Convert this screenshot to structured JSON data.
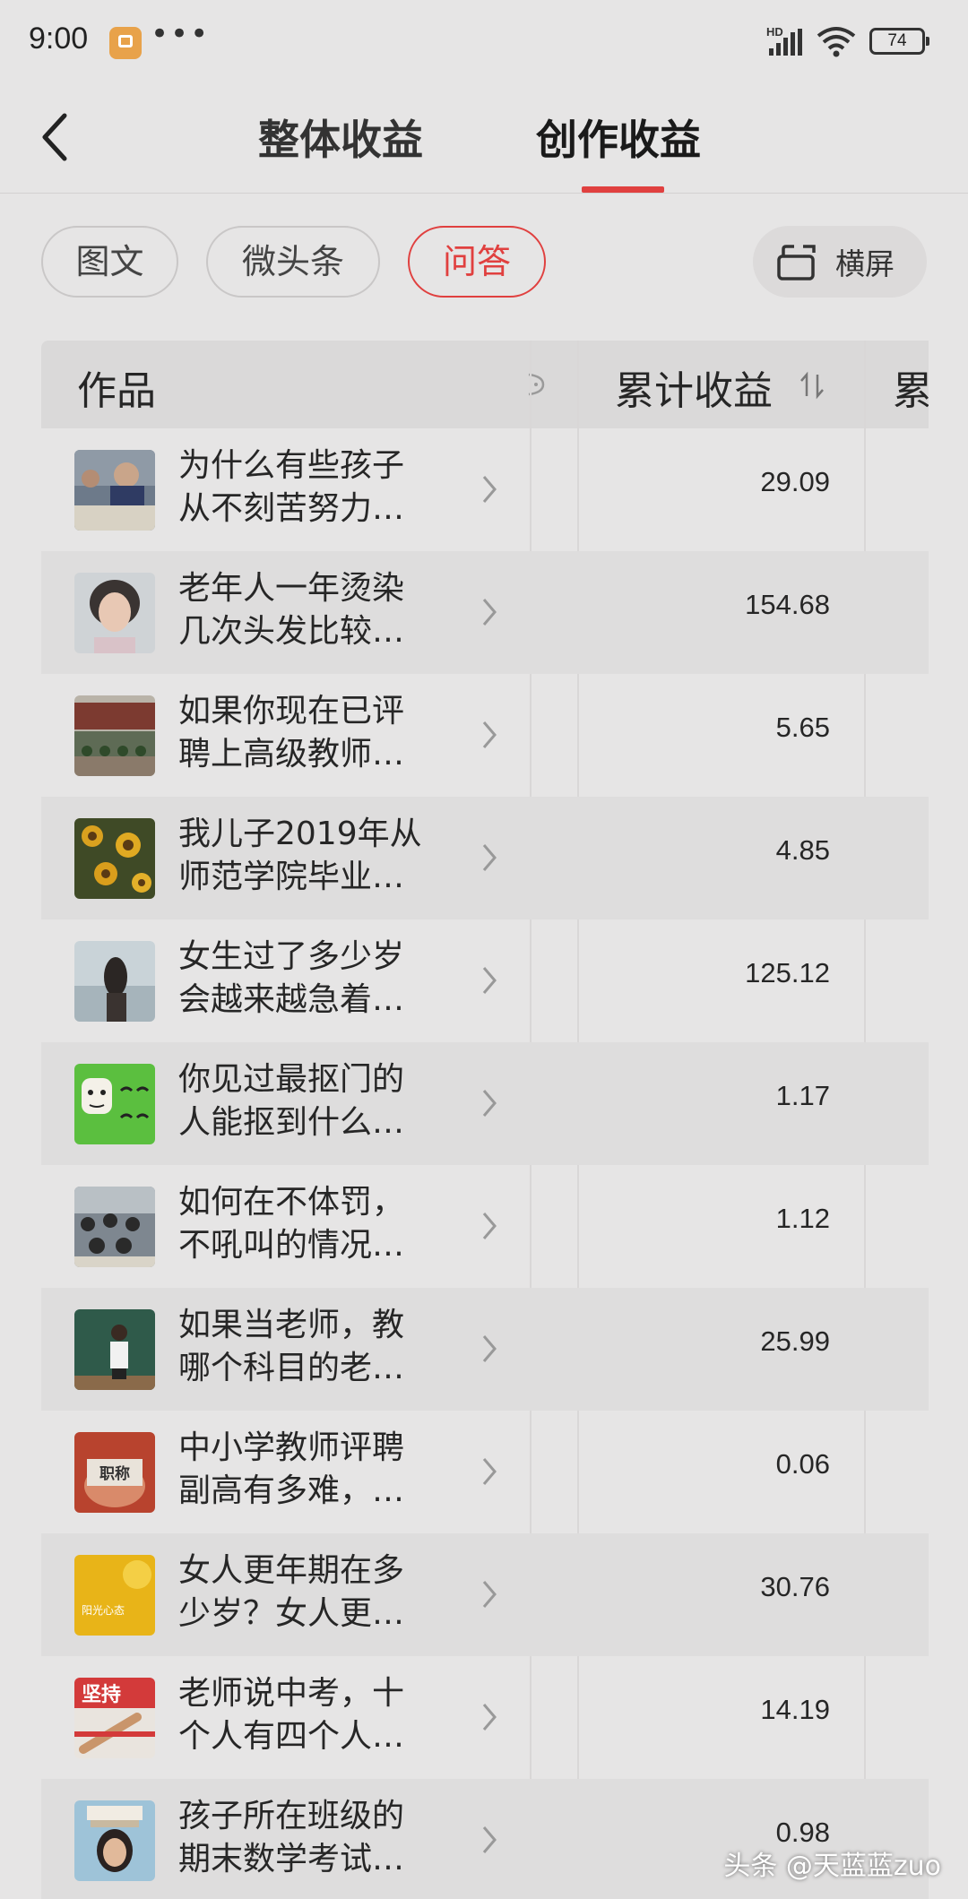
{
  "status": {
    "time": "9:00",
    "hd": "HD",
    "battery": "74"
  },
  "nav": {
    "tabs": [
      "整体收益",
      "创作收益"
    ],
    "active_tab": "创作收益"
  },
  "filters": {
    "chips": [
      "图文",
      "微头条",
      "问答"
    ],
    "active": "问答",
    "landscape_label": "横屏"
  },
  "table": {
    "col_work": "作品",
    "col_earnings": "累计收益",
    "col_next": "累",
    "rows": [
      {
        "title_line1": "为什么有些孩子",
        "title_line2": "从不刻苦努力…",
        "earnings": "29.09",
        "thumb": "students-studying"
      },
      {
        "title_line1": "老年人一年烫染",
        "title_line2": "几次头发比较…",
        "earnings": "154.68",
        "thumb": "elderly-woman-portrait"
      },
      {
        "title_line1": "如果你现在已评",
        "title_line2": "聘上高级教师…",
        "earnings": "5.65",
        "thumb": "school-stage"
      },
      {
        "title_line1": "我儿子2019年从",
        "title_line2": "师范学院毕业…",
        "earnings": "4.85",
        "thumb": "sunflowers"
      },
      {
        "title_line1": "女生过了多少岁",
        "title_line2": "会越来越急着…",
        "earnings": "125.12",
        "thumb": "girl-by-sea"
      },
      {
        "title_line1": "你见过最抠门的",
        "title_line2": "人能抠到什么…",
        "earnings": "1.17",
        "thumb": "cartoon-faces"
      },
      {
        "title_line1": "如何在不体罚，",
        "title_line2": "不吼叫的情况…",
        "earnings": "1.12",
        "thumb": "classroom"
      },
      {
        "title_line1": "如果当老师，教",
        "title_line2": "哪个科目的老…",
        "earnings": "25.99",
        "thumb": "teacher-blackboard"
      },
      {
        "title_line1": "中小学教师评聘",
        "title_line2": "副高有多难，…",
        "earnings": "0.06",
        "thumb": "title-card"
      },
      {
        "title_line1": "女人更年期在多",
        "title_line2": "少岁？女人更…",
        "earnings": "30.76",
        "thumb": "yellow-sunshine"
      },
      {
        "title_line1": "老师说中考，十",
        "title_line2": "个人有四个人…",
        "earnings": "14.19",
        "thumb": "persist-poster"
      },
      {
        "title_line1": "孩子所在班级的",
        "title_line2": "期末数学考试…",
        "earnings": "0.98",
        "thumb": "girl-with-books"
      }
    ]
  },
  "thumb_text": {
    "title_card": "职称",
    "persist": "坚持",
    "yellow_caption": "阳光心态"
  },
  "watermark": "头条 @天蓝蓝zuo",
  "colors": {
    "accent": "#e0403f",
    "background": "#e6e5e5"
  }
}
